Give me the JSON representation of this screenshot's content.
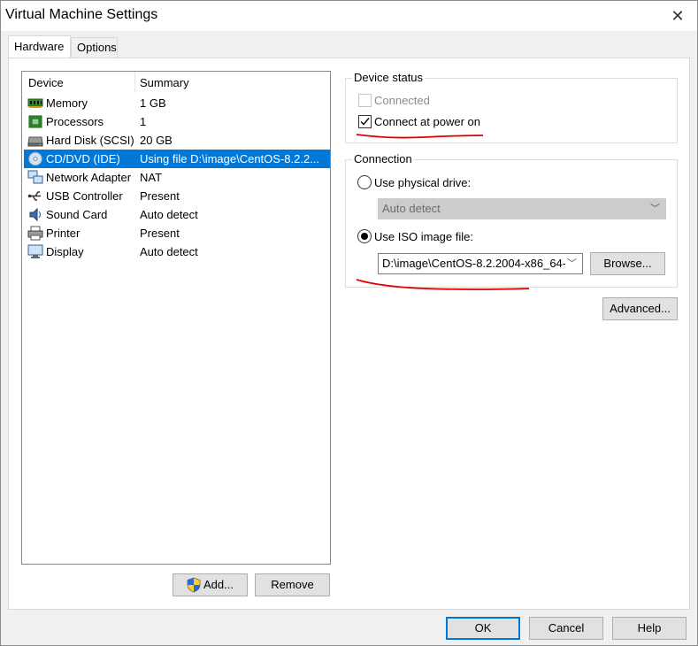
{
  "window": {
    "title": "Virtual Machine Settings",
    "close_glyph": "✕"
  },
  "tabs": [
    {
      "label": "Hardware",
      "active": true
    },
    {
      "label": "Options",
      "active": false
    }
  ],
  "device_list": {
    "columns": [
      "Device",
      "Summary"
    ],
    "rows": [
      {
        "device": "Memory",
        "summary": "1 GB",
        "icon": "memory-icon"
      },
      {
        "device": "Processors",
        "summary": "1",
        "icon": "processor-icon"
      },
      {
        "device": "Hard Disk (SCSI)",
        "summary": "20 GB",
        "icon": "hard-disk-icon"
      },
      {
        "device": "CD/DVD (IDE)",
        "summary": "Using file D:\\image\\CentOS-8.2.2...",
        "icon": "cd-dvd-icon",
        "selected": true
      },
      {
        "device": "Network Adapter",
        "summary": "NAT",
        "icon": "network-adapter-icon"
      },
      {
        "device": "USB Controller",
        "summary": "Present",
        "icon": "usb-icon"
      },
      {
        "device": "Sound Card",
        "summary": "Auto detect",
        "icon": "sound-card-icon"
      },
      {
        "device": "Printer",
        "summary": "Present",
        "icon": "printer-icon"
      },
      {
        "device": "Display",
        "summary": "Auto detect",
        "icon": "display-icon"
      }
    ],
    "add_label": "Add...",
    "remove_label": "Remove"
  },
  "device_status": {
    "title": "Device status",
    "connected_label": "Connected",
    "connected_checked": false,
    "connect_power_label": "Connect at power on",
    "connect_power_checked": true
  },
  "connection": {
    "title": "Connection",
    "physical_label": "Use physical drive:",
    "physical_value": "Auto detect",
    "iso_label": "Use ISO image file:",
    "iso_value": "D:\\image\\CentOS-8.2.2004-x86_64-",
    "browse_label": "Browse...",
    "selected": "iso"
  },
  "advanced_label": "Advanced...",
  "footer": {
    "ok": "OK",
    "cancel": "Cancel",
    "help": "Help"
  },
  "colors": {
    "selection": "#0078d7",
    "annotation": "#e00000"
  }
}
